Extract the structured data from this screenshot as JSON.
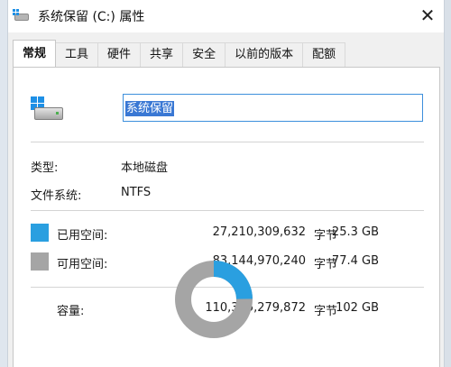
{
  "window": {
    "title": "系统保留 (C:) 属性",
    "close_glyph": "✕"
  },
  "tabs": [
    {
      "label": "常规",
      "active": true
    },
    {
      "label": "工具",
      "active": false
    },
    {
      "label": "硬件",
      "active": false
    },
    {
      "label": "共享",
      "active": false
    },
    {
      "label": "安全",
      "active": false
    },
    {
      "label": "以前的版本",
      "active": false
    },
    {
      "label": "配额",
      "active": false
    }
  ],
  "general": {
    "drive_name_value": "系统保留",
    "type_label": "类型:",
    "type_value": "本地磁盘",
    "fs_label": "文件系统:",
    "fs_value": "NTFS",
    "used_label": "已用空间:",
    "used_bytes": "27,210,309,632",
    "used_unit": "字节",
    "used_gb": "25.3 GB",
    "free_label": "可用空间:",
    "free_bytes": "83,144,970,240",
    "free_unit": "字节",
    "free_gb": "77.4 GB",
    "capacity_label": "容量:",
    "capacity_bytes": "110,355,279,872",
    "capacity_unit": "字节",
    "capacity_gb": "102 GB"
  },
  "colors": {
    "used": "#2a9fe0",
    "free": "#a5a5a5",
    "accent": "#3d8fdc"
  },
  "usage": {
    "used_fraction": 0.247
  },
  "icons": {
    "title": "drive-icon",
    "close": "close-icon",
    "drive": "windows-drive-icon"
  }
}
